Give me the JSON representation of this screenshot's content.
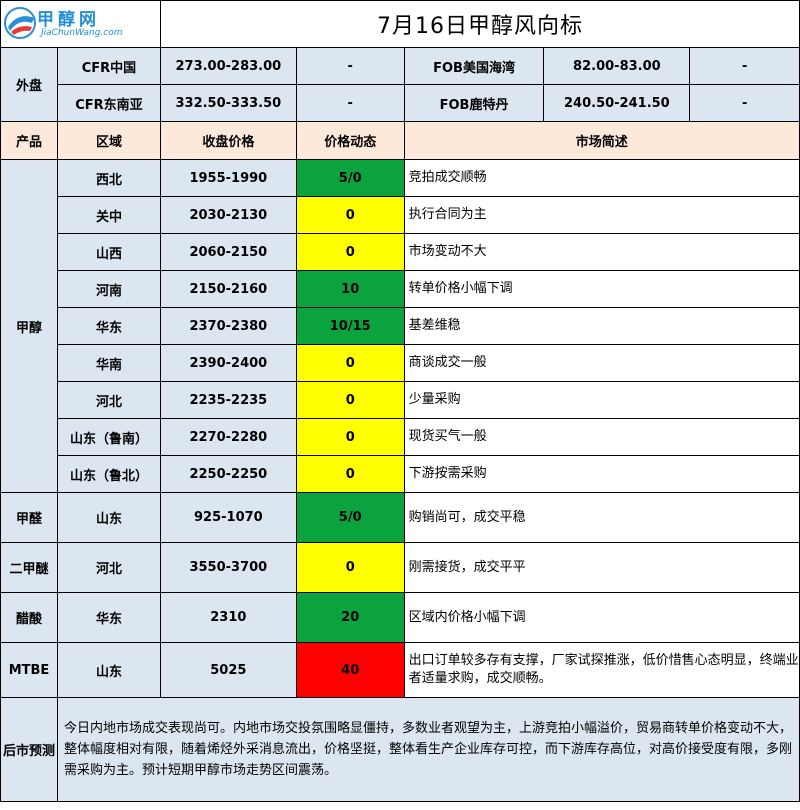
{
  "logo": {
    "name": "甲醇网",
    "sub": "JiaChunWang.com"
  },
  "title": "7月16日甲醇风向标",
  "outer": {
    "label": "外盘",
    "rows": [
      {
        "left_name": "CFR中国",
        "left_price": "273.00-283.00",
        "left_change": "-",
        "right_name": "FOB美国海湾",
        "right_price": "82.00-83.00",
        "right_change": "-"
      },
      {
        "left_name": "CFR东南亚",
        "left_price": "332.50-333.50",
        "left_change": "-",
        "right_name": "FOB鹿特丹",
        "right_price": "240.50-241.50",
        "right_change": "-"
      }
    ]
  },
  "headers": {
    "product": "产品",
    "region": "区域",
    "price": "收盘价格",
    "dynamic": "价格动态",
    "summary": "市场简述"
  },
  "methanol": {
    "label": "甲醇",
    "rows": [
      {
        "region": "西北",
        "price": "1955-1990",
        "change": "5/0",
        "status": "green",
        "desc": "竞拍成交顺畅"
      },
      {
        "region": "关中",
        "price": "2030-2130",
        "change": "0",
        "status": "yellow",
        "desc": "执行合同为主"
      },
      {
        "region": "山西",
        "price": "2060-2150",
        "change": "0",
        "status": "yellow",
        "desc": "市场变动不大"
      },
      {
        "region": "河南",
        "price": "2150-2160",
        "change": "10",
        "status": "green",
        "desc": "转单价格小幅下调"
      },
      {
        "region": "华东",
        "price": "2370-2380",
        "change": "10/15",
        "status": "green",
        "desc": "基差维稳"
      },
      {
        "region": "华南",
        "price": "2390-2400",
        "change": "0",
        "status": "yellow",
        "desc": "商谈成交一般"
      },
      {
        "region": "河北",
        "price": "2235-2235",
        "change": "0",
        "status": "yellow",
        "desc": "少量采购"
      },
      {
        "region": "山东（鲁南）",
        "price": "2270-2280",
        "change": "0",
        "status": "yellow",
        "desc": "现货买气一般"
      },
      {
        "region": "山东（鲁北）",
        "price": "2250-2250",
        "change": "0",
        "status": "yellow",
        "desc": "下游按需采购"
      }
    ]
  },
  "others": [
    {
      "product": "甲醛",
      "region": "山东",
      "price": "925-1070",
      "change": "5/0",
      "status": "green",
      "desc": "购销尚可，成交平稳"
    },
    {
      "product": "二甲醚",
      "region": "河北",
      "price": "3550-3700",
      "change": "0",
      "status": "yellow",
      "desc": "刚需接货，成交平平"
    },
    {
      "product": "醋酸",
      "region": "华东",
      "price": "2310",
      "change": "20",
      "status": "green",
      "desc": "区域内价格小幅下调"
    },
    {
      "product": "MTBE",
      "region": "山东",
      "price": "5025",
      "change": "40",
      "status": "red",
      "desc": "出口订单较多存有支撑，厂家试探推涨，低价惜售心态明显，终端业者适量求购，成交顺畅。"
    }
  ],
  "forecast": {
    "label": "后市预测",
    "text": "今日内地市场成交表现尚可。内地市场交投氛围略显僵持，多数业者观望为主，上游竞拍小幅溢价，贸易商转单价格变动不大，整体幅度相对有限，随着烯烃外采消息流出，价格坚挺，整体看生产企业库存可控，而下游库存高位，对高价接受度有限，多刚需采购为主。预计短期甲醇市场走势区间震荡。"
  }
}
